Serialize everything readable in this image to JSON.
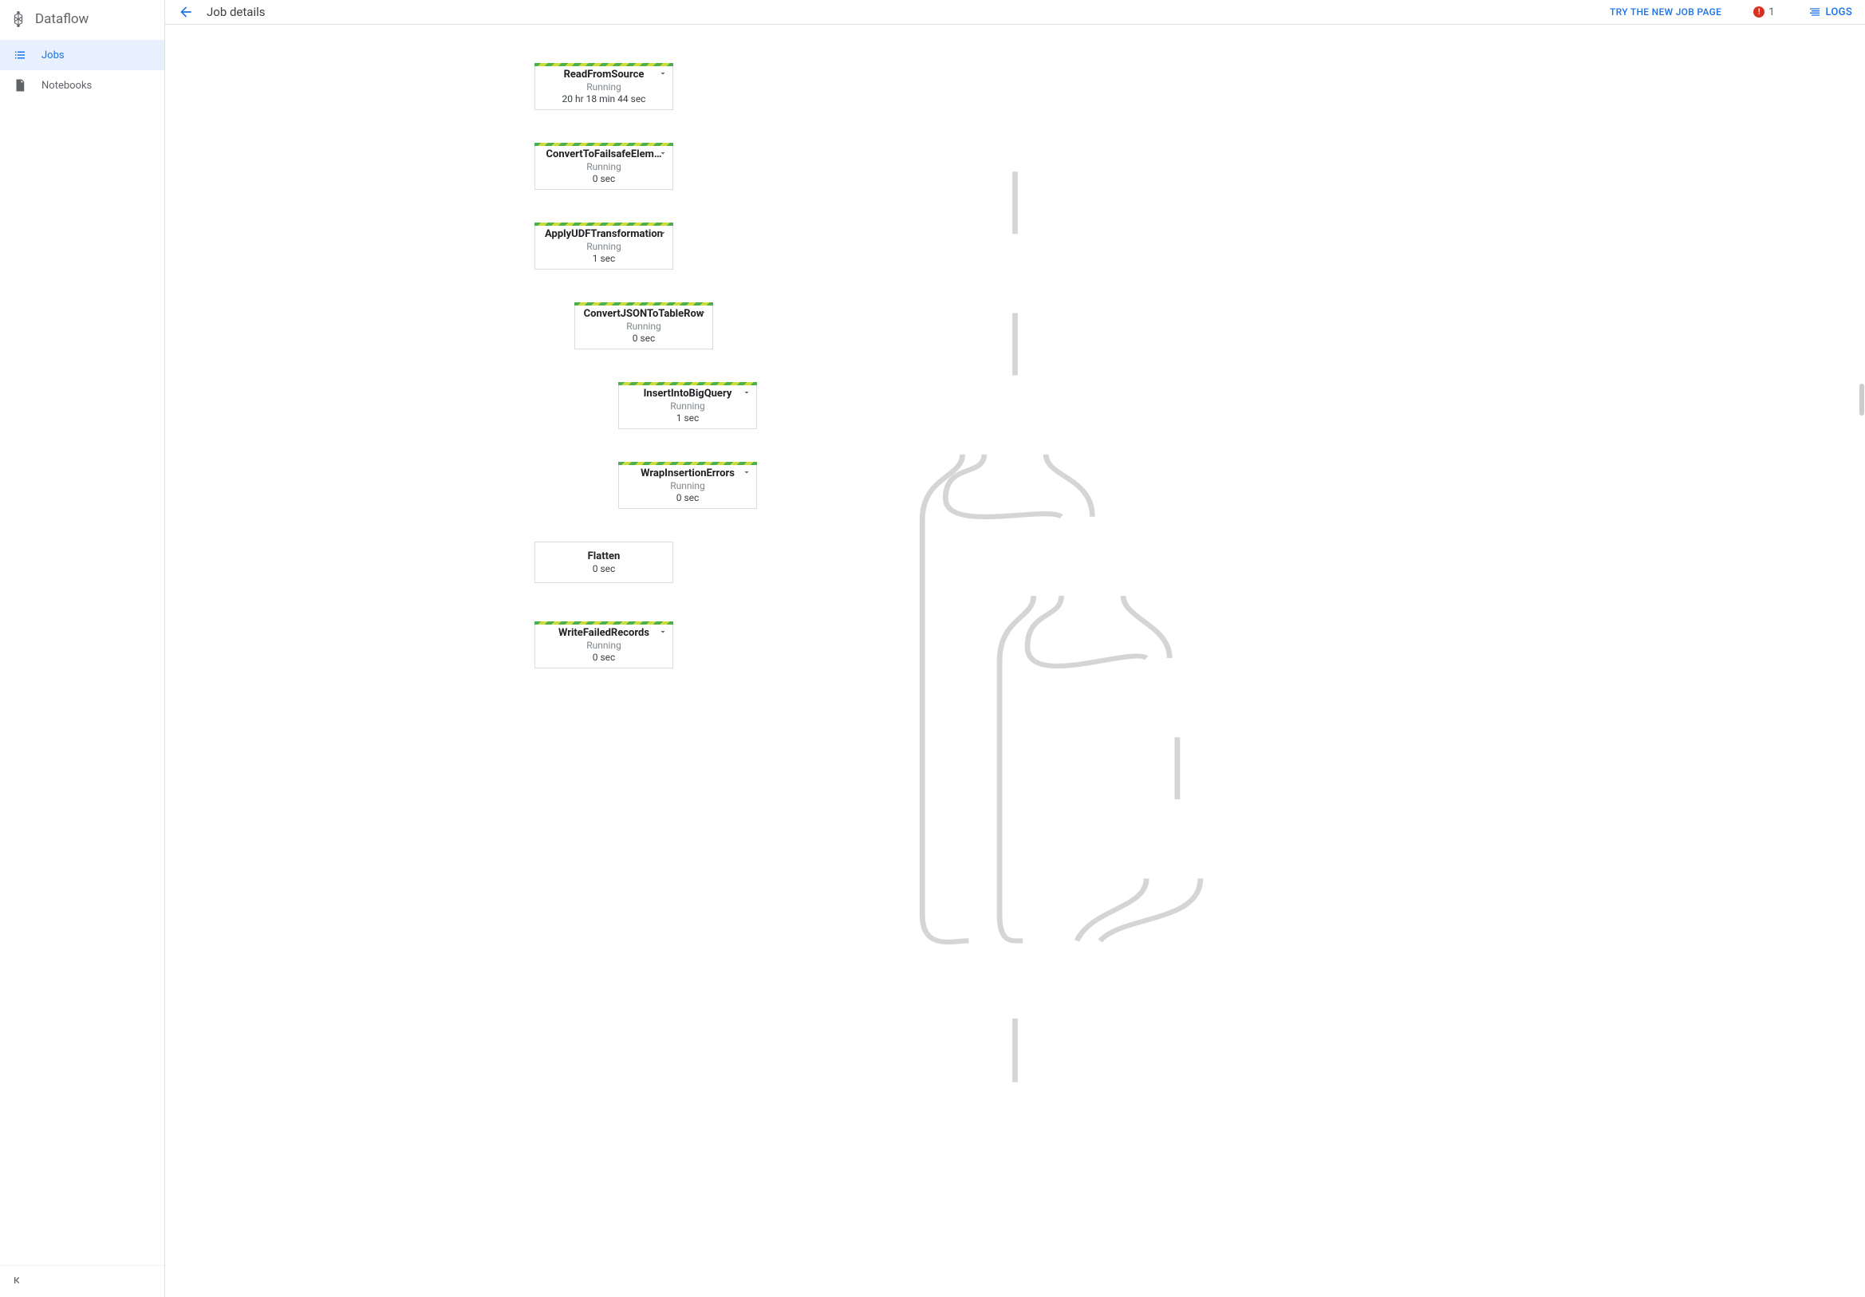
{
  "product": {
    "name": "Dataflow"
  },
  "sidebar": {
    "items": [
      {
        "label": "Jobs"
      },
      {
        "label": "Notebooks"
      }
    ]
  },
  "header": {
    "title": "Job details",
    "try_link": "TRY THE NEW JOB PAGE",
    "error_count": "1",
    "logs_label": "LOGS"
  },
  "nodes": {
    "n0": {
      "title": "ReadFromSource",
      "status": "Running",
      "duration": "20 hr 18 min 44 sec"
    },
    "n1": {
      "title": "ConvertToFailsafeElem…",
      "status": "Running",
      "duration": "0 sec"
    },
    "n2": {
      "title": "ApplyUDFTransformation",
      "status": "Running",
      "duration": "1 sec"
    },
    "n3": {
      "title": "ConvertJSONToTableRow",
      "status": "Running",
      "duration": "0 sec"
    },
    "n4": {
      "title": "InsertIntoBigQuery",
      "status": "Running",
      "duration": "1 sec"
    },
    "n5": {
      "title": "WrapInsertionErrors",
      "status": "Running",
      "duration": "0 sec"
    },
    "n6": {
      "title": "Flatten",
      "duration": "0 sec"
    },
    "n7": {
      "title": "WriteFailedRecords",
      "status": "Running",
      "duration": "0 sec"
    }
  }
}
